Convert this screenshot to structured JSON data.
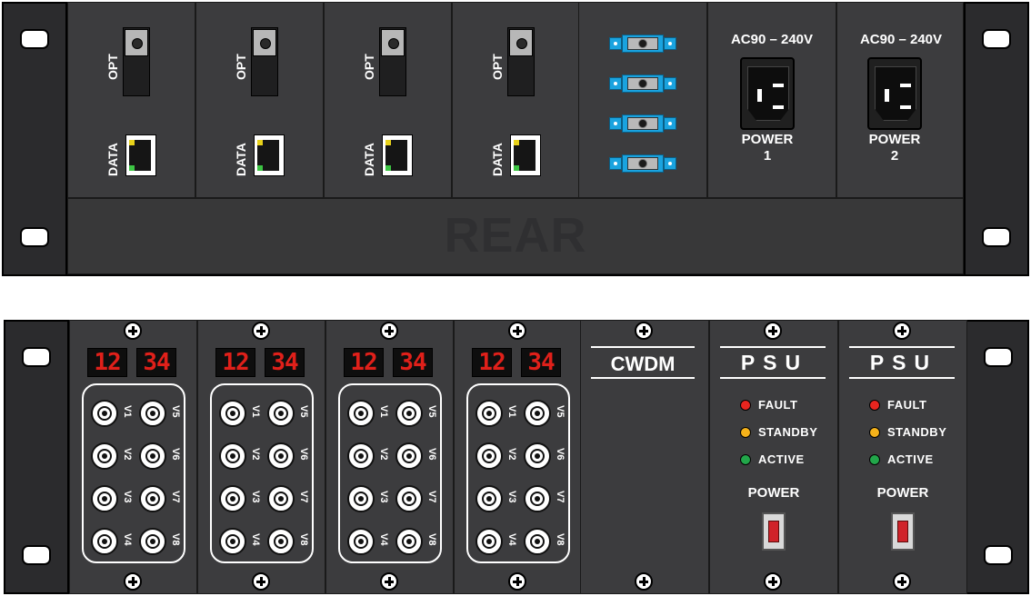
{
  "rear_panel": {
    "label": "REAR",
    "cards": [
      {
        "opt_label": "OPT",
        "data_label": "DATA"
      },
      {
        "opt_label": "OPT",
        "data_label": "DATA"
      },
      {
        "opt_label": "OPT",
        "data_label": "DATA"
      },
      {
        "opt_label": "OPT",
        "data_label": "DATA"
      }
    ],
    "fc_connector_count": 4,
    "power_inlets": [
      {
        "voltage": "AC90 – 240V",
        "label": "POWER",
        "number": "1"
      },
      {
        "voltage": "AC90 – 240V",
        "label": "POWER",
        "number": "2"
      }
    ]
  },
  "front_panel": {
    "video_cards": [
      {
        "display_left": "12",
        "display_right": "34",
        "channels": [
          "V1",
          "V2",
          "V3",
          "V4",
          "V5",
          "V6",
          "V7",
          "V8"
        ]
      },
      {
        "display_left": "12",
        "display_right": "34",
        "channels": [
          "V1",
          "V2",
          "V3",
          "V4",
          "V5",
          "V6",
          "V7",
          "V8"
        ]
      },
      {
        "display_left": "12",
        "display_right": "34",
        "channels": [
          "V1",
          "V2",
          "V3",
          "V4",
          "V5",
          "V6",
          "V7",
          "V8"
        ]
      },
      {
        "display_left": "12",
        "display_right": "34",
        "channels": [
          "V1",
          "V2",
          "V3",
          "V4",
          "V5",
          "V6",
          "V7",
          "V8"
        ]
      }
    ],
    "cwdm": {
      "title": "CWDM"
    },
    "psus": [
      {
        "title": "PSU",
        "fault": "FAULT",
        "standby": "STANDBY",
        "active": "ACTIVE",
        "power": "POWER"
      },
      {
        "title": "PSU",
        "fault": "FAULT",
        "standby": "STANDBY",
        "active": "ACTIVE",
        "power": "POWER"
      }
    ]
  },
  "colors": {
    "chassis": "#3a3a3c",
    "led_fault": "#e8251f",
    "led_standby": "#f5b21a",
    "led_active": "#22a64a",
    "fc_blue": "#1aa3df",
    "segment_red": "#e0201a"
  }
}
